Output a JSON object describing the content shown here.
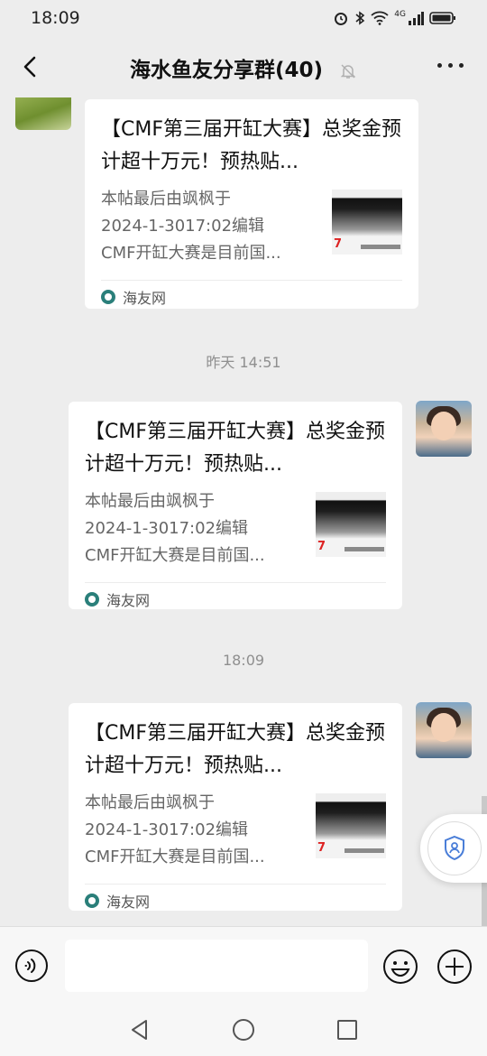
{
  "status_bar": {
    "time": "18:09",
    "network": "4G",
    "icons": [
      "alarm-icon",
      "bluetooth-icon",
      "wifi-icon",
      "signal-icon",
      "battery-icon"
    ]
  },
  "header": {
    "title": "海水鱼友分享群(40)",
    "icons": [
      "back-arrow-icon",
      "mute-bell-icon",
      "more-dots-icon"
    ]
  },
  "messages": [
    {
      "sender_side": "left",
      "card": {
        "title": "【CMF第三届开缸大赛】总奖金预计超十万元！预热贴...",
        "desc_lines": [
          "本帖最后由飒枫于",
          "2024-1-3017:02编辑",
          "CMF开缸大赛是目前国..."
        ],
        "source": "海友网"
      }
    },
    {
      "timestamp": "昨天 14:51"
    },
    {
      "sender_side": "right",
      "card": {
        "title": "【CMF第三届开缸大赛】总奖金预计超十万元！预热贴...",
        "desc_lines": [
          "本帖最后由飒枫于",
          "2024-1-3017:02编辑",
          "CMF开缸大赛是目前国..."
        ],
        "source": "海友网"
      }
    },
    {
      "timestamp": "18:09"
    },
    {
      "sender_side": "right",
      "card": {
        "title": "【CMF第三届开缸大赛】总奖金预计超十万元！预热贴...",
        "desc_lines": [
          "本帖最后由飒枫于",
          "2024-1-3017:02编辑",
          "CMF开缸大赛是目前国..."
        ],
        "source": "海友网"
      }
    }
  ],
  "input_bar": {
    "text_value": "",
    "icons": [
      "voice-icon",
      "emoji-icon",
      "plus-icon"
    ]
  },
  "floating_button": {
    "icon": "shield-person-icon"
  },
  "system_nav": {
    "icons": [
      "nav-back-icon",
      "nav-home-icon",
      "nav-recents-icon"
    ]
  },
  "colors": {
    "background": "#ededed",
    "card": "#ffffff",
    "muted_text": "#666666",
    "source_icon": "#2a7f7a"
  }
}
